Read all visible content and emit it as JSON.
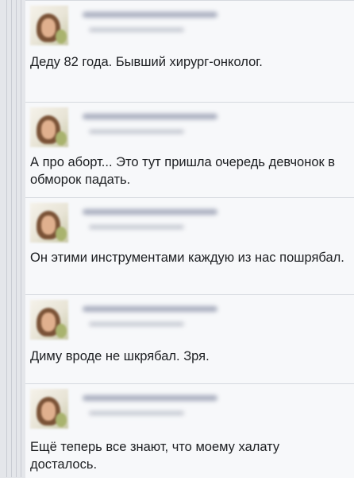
{
  "comments": [
    {
      "avatar_icon": "profile-photo-icon",
      "text": "Деду 82 года. Бывший хирург-онколог."
    },
    {
      "avatar_icon": "profile-photo-icon",
      "text": "А про аборт... Это тут пришла очередь девчонок в обморок падать."
    },
    {
      "avatar_icon": "profile-photo-icon",
      "text": "Он этими инструментами каждую из нас пошрябал."
    },
    {
      "avatar_icon": "profile-photo-icon",
      "text": "Диму вроде не шкрябал. Зря."
    },
    {
      "avatar_icon": "profile-photo-icon",
      "text": "Ещё теперь все знают, что моему халату досталось."
    }
  ]
}
